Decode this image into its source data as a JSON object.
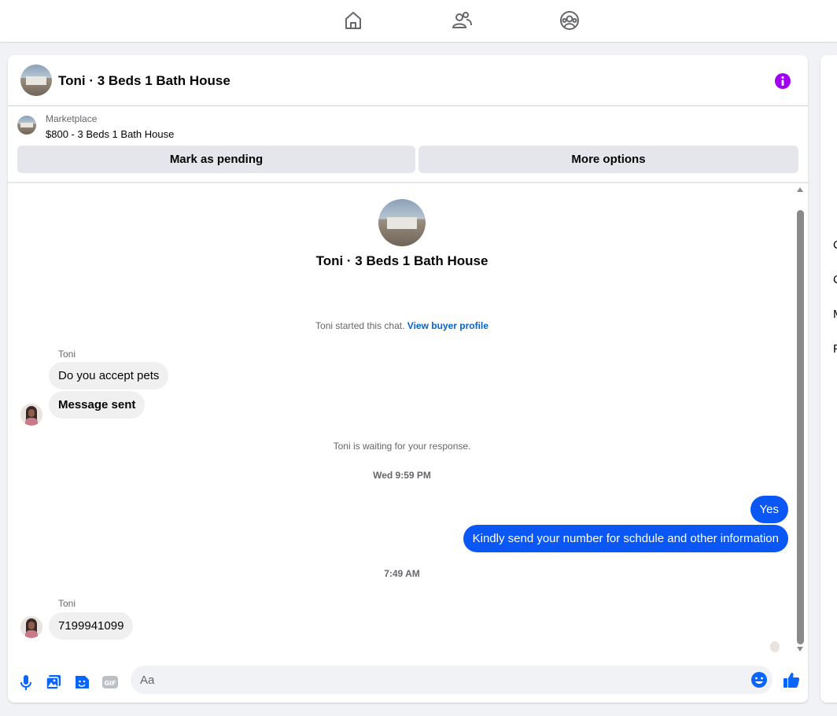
{
  "topnav": {
    "items": [
      {
        "icon": "home-icon"
      },
      {
        "icon": "friends-icon"
      },
      {
        "icon": "groups-icon"
      }
    ]
  },
  "header": {
    "title": "Toni · 3 Beds 1 Bath House",
    "info_icon": "info-icon",
    "info_color": "#a200f5"
  },
  "marketplace": {
    "label": "Marketplace",
    "listing": "$800 - 3 Beds 1 Bath House",
    "mark_pending_label": "Mark as pending",
    "more_options_label": "More options"
  },
  "conversation": {
    "title": "Toni · 3 Beds 1 Bath House",
    "started_text": "Toni started this chat.",
    "view_profile_link": "View buyer profile",
    "waiting_text": "Toni is waiting for your response.",
    "timestamp_1": "Wed 9:59 PM",
    "timestamp_2": "7:49 AM",
    "messages": [
      {
        "sender": "Toni",
        "text": "Do you accept pets",
        "direction": "incoming"
      },
      {
        "text": "Message sent",
        "direction": "incoming"
      },
      {
        "text": "Yes",
        "direction": "outgoing"
      },
      {
        "text": "Kindly send your number for schdule and other information",
        "direction": "outgoing"
      },
      {
        "sender": "Toni",
        "text": "7199941099",
        "direction": "incoming"
      }
    ]
  },
  "composer": {
    "placeholder": "Aa",
    "icons": [
      "microphone-icon",
      "photo-icon",
      "sticker-icon",
      "gif-icon",
      "emoji-icon",
      "like-icon"
    ],
    "accent_color": "#0866ff"
  },
  "right_panel": {
    "letters": [
      "C",
      "C",
      "M",
      "P"
    ]
  },
  "colors": {
    "outgoing_bubble": "#0b57f5",
    "incoming_bubble": "#f0f0f0",
    "link": "#0064d1"
  }
}
